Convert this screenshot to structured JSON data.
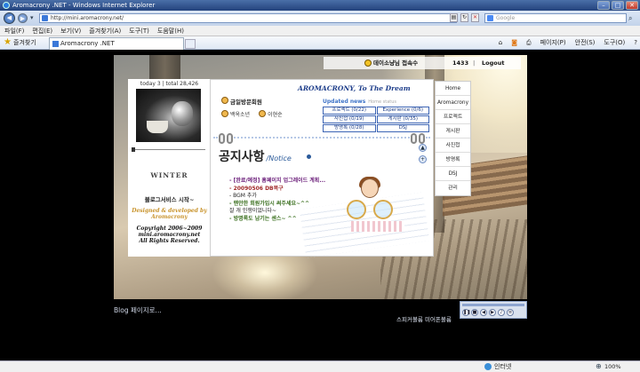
{
  "window": {
    "title": "Aromacrony .NET - Windows Internet Explorer"
  },
  "addressbar": {
    "url": "http://mini.aromacrony.net/",
    "search_placeholder": "Google"
  },
  "menubar": [
    "파일(F)",
    "편집(E)",
    "보기(V)",
    "즐겨찾기(A)",
    "도구(T)",
    "도움말(H)"
  ],
  "favorites": {
    "label": "즐겨찾기",
    "tab_title": "Aromacrony .NET"
  },
  "commandbar": [
    "페이지(P)",
    "안전(S)",
    "도구(O)"
  ],
  "site": {
    "visitor": "데이소냥님 접속수",
    "visit_count": "1433",
    "logout": "Logout",
    "counter": "today 3 | total 28,426",
    "season": "WINTER",
    "service_start": "블로그서비스 시작~",
    "designed_by": [
      "Designed & developed by",
      "Aromacrony"
    ],
    "copyright": [
      "Copyright 2006~2009",
      "mini.aromacrony.net",
      "All Rights Reserved."
    ],
    "center_title": "AROMACRONY, To The Dream",
    "visit_board": "금일방문회원",
    "people": [
      "백옥소년",
      "이현순"
    ],
    "updated_news": "Updated news",
    "updated_sub": "Home status",
    "news_grid": [
      "프로젝트 (0/22)",
      "Experience (0/6)",
      "사진첩 (0/19)",
      "게시판 (0/35)",
      "방명록 (0/28)",
      "DSJ"
    ],
    "notice_title": "공지사항",
    "notice_sub": "/Notice",
    "notice_lines": [
      "- [완료/예정] 홈페이지 업그레이드 계획...",
      "- 20090506 DB복구",
      "- BGM 추가",
      "- 맨안한 회원가입시 써주세요~^^",
      "  잘 개 인쟁이었니다~",
      "- 방명록도 남기는 센스~ ^^"
    ],
    "nav": [
      "Home",
      "Aromacrony",
      "프로젝트",
      "게시판",
      "사진첩",
      "방명록",
      "DSJ",
      "관리"
    ],
    "blog_link": "Blog 페이지로...",
    "speaker_text": "스피커볼륨 미어폰볼륨"
  },
  "status": {
    "zone": "인터넷",
    "zoom": "100%"
  }
}
